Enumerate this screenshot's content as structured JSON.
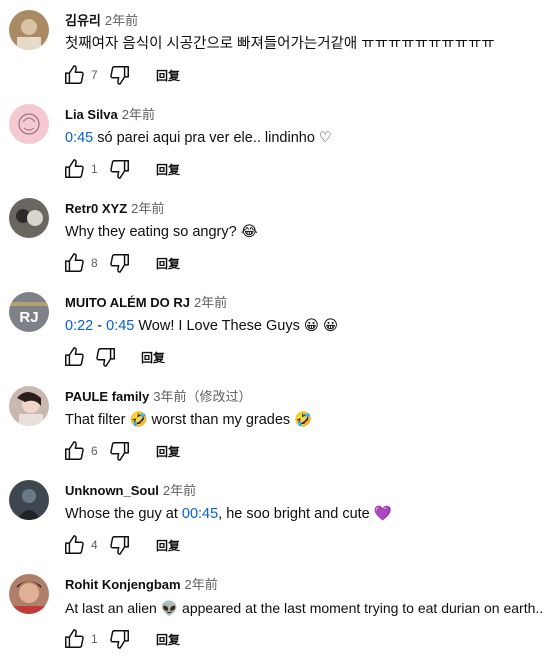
{
  "reply_label": "回复",
  "comments": [
    {
      "author": "김유리",
      "time": "2年前",
      "text": "첫째여자 음식이 시공간으로 빠져들어가는거같애 ㅠㅠㅠㅠㅠㅠㅠㅠㅠㅠ",
      "likes": "7",
      "avatar_color": "#a98a63"
    },
    {
      "author": "Lia Silva",
      "time": "2年前",
      "ts": "0:45",
      "text": " só parei aqui pra ver ele.. lindinho ♡",
      "likes": "1",
      "avatar_color": "#f4c9cf"
    },
    {
      "author": "Retr0 XYZ",
      "time": "2年前",
      "text": "Why they eating so angry? 😂",
      "likes": "8",
      "avatar_color": "#6b6660"
    },
    {
      "author": "MUITO ALÉM DO RJ",
      "time": "2年前",
      "ts": "0:22",
      "sep": " - ",
      "ts2": "0:45",
      "text": " Wow! I Love These Guys 😀 😀",
      "likes": "",
      "avatar_color": "#7d8288",
      "avatar_text": "RJ"
    },
    {
      "author": "PAULE family",
      "time": "3年前（修改过）",
      "text": "That filter 🤣 worst than my grades 🤣",
      "likes": "6",
      "avatar_color": "#c9b8b0"
    },
    {
      "author": "Unknown_Soul",
      "time": "2年前",
      "text_before": "Whose the guy at ",
      "ts": "00:45",
      "text": ", he soo bright and cute 💜",
      "likes": "4",
      "avatar_color": "#3e4650"
    },
    {
      "author": "Rohit Konjengbam",
      "time": "2年前",
      "text": "At last an alien 👽 appeared at the last moment trying to eat durian on earth..",
      "likes": "1",
      "avatar_color": "#b07f6a"
    }
  ]
}
